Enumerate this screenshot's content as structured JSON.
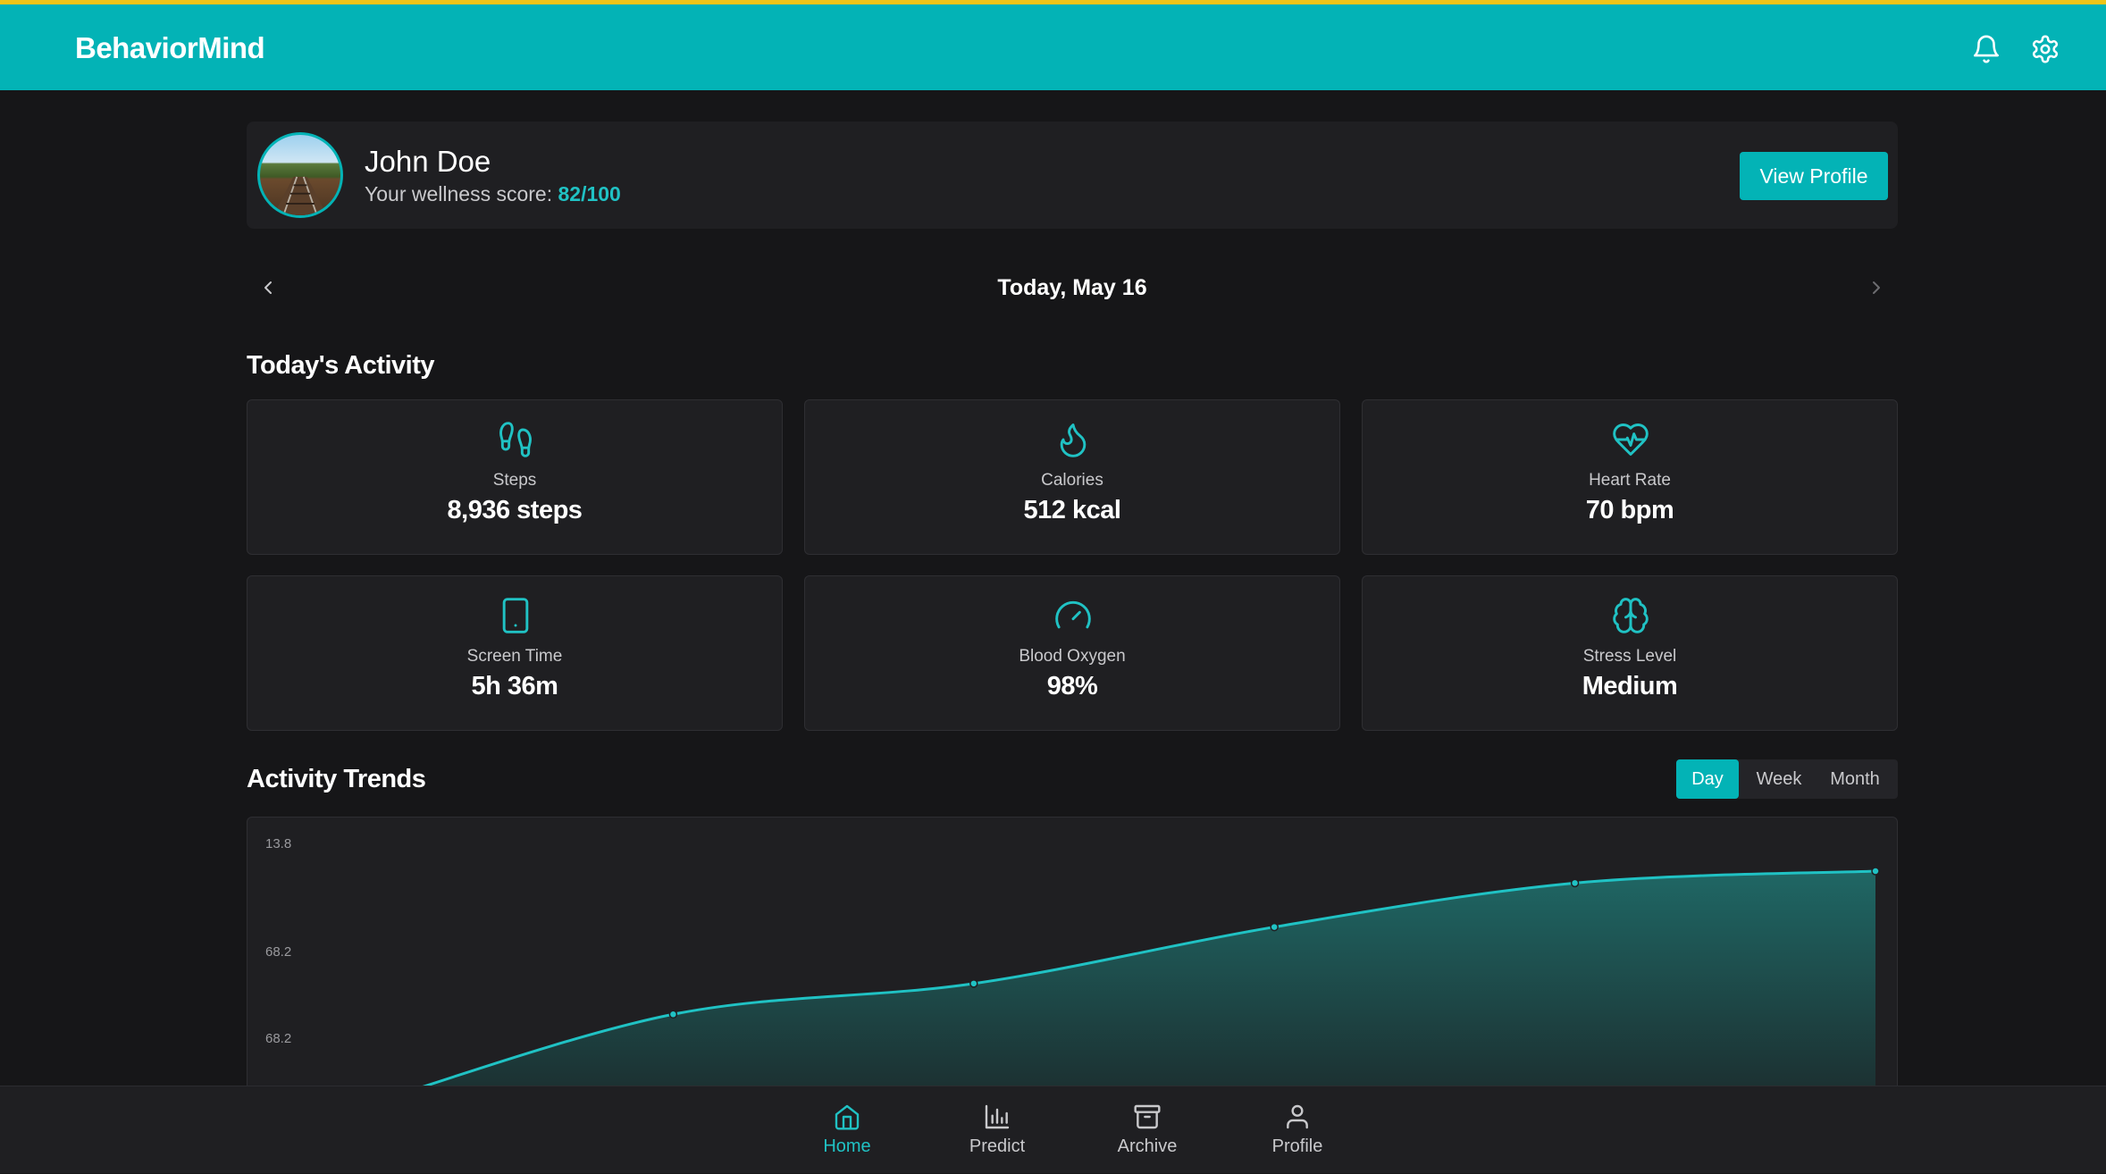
{
  "app": {
    "brand": "BehaviorMind",
    "icons": {
      "notifications": "bell-icon",
      "settings": "gear-icon"
    },
    "colors": {
      "accent": "#03b3b6",
      "accent_text": "#20c2c4",
      "top_stripe": "#f0c419",
      "background": "#161618",
      "card": "#1f1f22"
    }
  },
  "profile": {
    "name": "John Doe",
    "wellness_label": "Your wellness score: ",
    "wellness_score": "82/100",
    "view_profile_label": "View Profile"
  },
  "date_nav": {
    "label": "Today, May 16",
    "prev_icon": "chevron-left-icon",
    "next_icon": "chevron-right-icon"
  },
  "activity": {
    "title": "Today's Activity",
    "stats": [
      {
        "icon": "footprints-icon",
        "label": "Steps",
        "value": "8,936 steps"
      },
      {
        "icon": "flame-icon",
        "label": "Calories",
        "value": "512 kcal"
      },
      {
        "icon": "heart-pulse-icon",
        "label": "Heart Rate",
        "value": "70 bpm"
      },
      {
        "icon": "tablet-icon",
        "label": "Screen Time",
        "value": "5h 36m"
      },
      {
        "icon": "gauge-icon",
        "label": "Blood Oxygen",
        "value": "98%"
      },
      {
        "icon": "brain-icon",
        "label": "Stress Level",
        "value": "Medium"
      }
    ]
  },
  "trends": {
    "title": "Activity Trends",
    "ranges": [
      "Day",
      "Week",
      "Month"
    ],
    "active_range": "Day"
  },
  "chart_data": {
    "type": "area",
    "title": "",
    "xlabel": "",
    "ylabel": "",
    "ytick_labels": [
      "13.8",
      "68.2",
      "68.2"
    ],
    "grid": false,
    "legend": "none",
    "series": [
      {
        "color": "#20c2c4",
        "points": [
          [
            0,
            40
          ],
          [
            1,
            68.2
          ],
          [
            2,
            78
          ],
          [
            3,
            96
          ],
          [
            4,
            110
          ],
          [
            5,
            113.8
          ]
        ]
      }
    ]
  },
  "bottom_nav": {
    "items": [
      {
        "icon": "home-icon",
        "label": "Home",
        "active": true
      },
      {
        "icon": "bar-chart-icon",
        "label": "Predict",
        "active": false
      },
      {
        "icon": "archive-icon",
        "label": "Archive",
        "active": false
      },
      {
        "icon": "user-icon",
        "label": "Profile",
        "active": false
      }
    ]
  }
}
